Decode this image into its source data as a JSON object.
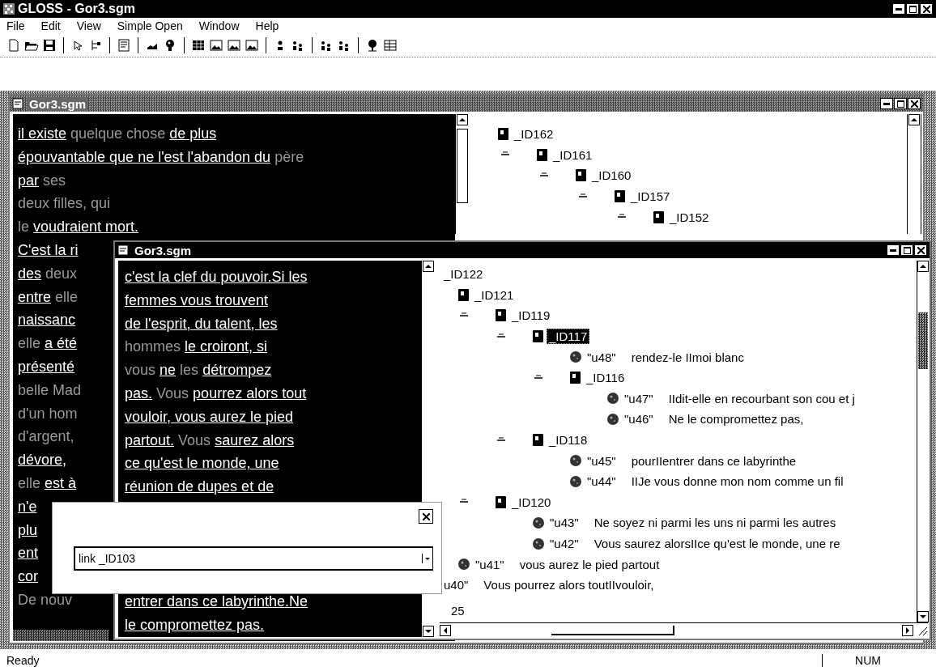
{
  "app_window": {
    "title": "GLOSS - Gor3.sgm"
  },
  "menu": [
    "File",
    "Edit",
    "View",
    "Simple Open",
    "Window",
    "Help"
  ],
  "back_window": {
    "title": "Gor3.sgm",
    "active": false,
    "text_lines": [
      [
        {
          "text": "il existe",
          "link": true
        },
        {
          "text": "quelque chose",
          "link": false
        },
        {
          "text": "de plus",
          "link": true
        }
      ],
      [
        {
          "text": "épouvantable que ne l'est l'abandon du",
          "link": true
        },
        {
          "text": "père",
          "link": false
        }
      ],
      [
        {
          "text": "par",
          "link": true
        },
        {
          "text": "ses",
          "link": false
        }
      ],
      [
        {
          "text": "deux filles, qui",
          "link": false
        }
      ],
      [
        {
          "text": "le",
          "link": false
        },
        {
          "text": "voudraient mort.",
          "link": true
        }
      ],
      [
        {
          "text": "C'est la ri",
          "link": true
        }
      ],
      [
        {
          "text": "des",
          "link": true
        },
        {
          "text": "deux",
          "link": false
        }
      ],
      [
        {
          "text": "entre",
          "link": true
        },
        {
          "text": "elle",
          "link": false
        }
      ],
      [
        {
          "text": "naissanc",
          "link": true
        }
      ],
      [
        {
          "text": "elle",
          "link": false
        },
        {
          "text": "a été",
          "link": true
        }
      ],
      [
        {
          "text": "présenté",
          "link": true
        }
      ],
      [
        {
          "text": "belle Mad",
          "link": false
        }
      ],
      [
        {
          "text": "d'un hom",
          "link": false
        }
      ],
      [
        {
          "text": "d'argent,",
          "link": false
        }
      ],
      [
        {
          "text": "dévore,",
          "link": true
        }
      ],
      [
        {
          "text": "elle",
          "link": false
        },
        {
          "text": "est à",
          "link": true
        }
      ],
      [
        {
          "text": "n'e",
          "link": true
        }
      ],
      [
        {
          "text": "plu",
          "link": true
        }
      ],
      [
        {
          "text": "ent",
          "link": true
        }
      ],
      [
        {
          "text": "cor",
          "link": true
        }
      ],
      [
        {
          "text": "De nouv",
          "link": false
        }
      ]
    ],
    "tree": [
      {
        "kind": "element",
        "label": "_ID162",
        "selected": false,
        "children": [
          {
            "kind": "element",
            "label": "_ID161",
            "expanded": true,
            "selected": false,
            "children": [
              {
                "kind": "element",
                "label": "_ID160",
                "expanded": true,
                "selected": false,
                "children": [
                  {
                    "kind": "element",
                    "label": "_ID157",
                    "expanded": true,
                    "selected": false,
                    "children": [
                      {
                        "kind": "element",
                        "label": "_ID152",
                        "expanded": true,
                        "selected": false
                      }
                    ]
                  }
                ]
              }
            ]
          }
        ]
      }
    ]
  },
  "front_window": {
    "title": "Gor3.sgm",
    "active": true,
    "text_above_dialog": [
      [
        {
          "text": "c'est la clef du pouvoir.Si les",
          "link": true
        }
      ],
      [
        {
          "text": "femmes vous trouvent",
          "link": true
        }
      ],
      [
        {
          "text": "de l'esprit, du talent, les",
          "link": true
        }
      ],
      [
        {
          "text": "hommes",
          "link": false
        },
        {
          "text": "le croiront, si",
          "link": true
        }
      ],
      [
        {
          "text": "vous",
          "link": false
        },
        {
          "text": "ne",
          "link": true
        },
        {
          "text": "les",
          "link": false
        },
        {
          "text": "détrompez",
          "link": true
        }
      ],
      [
        {
          "text": "pas.",
          "link": true
        },
        {
          "text": "Vous",
          "link": false
        },
        {
          "text": "pourrez alors tout",
          "link": true
        }
      ],
      [
        {
          "text": "vouloir, vous aurez le pied",
          "link": true
        }
      ],
      [
        {
          "text": "partout.",
          "link": true
        },
        {
          "text": "Vous",
          "link": false
        },
        {
          "text": "saurez alors",
          "link": true
        }
      ],
      [
        {
          "text": "ce qu'est le monde, une",
          "link": true
        }
      ],
      [
        {
          "text": "réunion de dupes et de",
          "link": true
        }
      ]
    ],
    "text_below_dialog": [
      [
        {
          "text": "entrer dans ce labyrinthe.Ne",
          "link": true
        }
      ],
      [
        {
          "text": "le compromettez pas.",
          "link": true
        }
      ]
    ],
    "tree": [
      {
        "kind": "clipped",
        "label": "_ID122",
        "selected": false,
        "children": [
          {
            "kind": "element",
            "label": "_ID121",
            "selected": false,
            "children": [
              {
                "kind": "element",
                "label": "_ID119",
                "expanded": true,
                "selected": false,
                "children": [
                  {
                    "kind": "element",
                    "label": "_ID117",
                    "expanded": true,
                    "selected": true,
                    "children": [
                      {
                        "kind": "text",
                        "label": "\"u48\"",
                        "text": "rendez-le IImoi blanc",
                        "selected": false
                      },
                      {
                        "kind": "element",
                        "label": "_ID116",
                        "expanded": true,
                        "selected": false,
                        "children": [
                          {
                            "kind": "text",
                            "label": "\"u47\"",
                            "text": "IIdit-elle en recourbant son cou et j",
                            "selected": false
                          },
                          {
                            "kind": "text",
                            "label": "\"u46\"",
                            "text": "Ne le compromettez pas,",
                            "selected": false
                          }
                        ]
                      }
                    ]
                  },
                  {
                    "kind": "element",
                    "label": "_ID118",
                    "expanded": true,
                    "selected": false,
                    "children": [
                      {
                        "kind": "text",
                        "label": "\"u45\"",
                        "text": "pourIIentrer dans ce labyrinthe",
                        "selected": false
                      },
                      {
                        "kind": "text",
                        "label": "\"u44\"",
                        "text": "IIJe vous donne mon nom comme un fil",
                        "selected": false
                      }
                    ]
                  }
                ]
              },
              {
                "kind": "element",
                "label": "_ID120",
                "expanded": true,
                "selected": false,
                "children": [
                  {
                    "kind": "text",
                    "label": "\"u43\"",
                    "text": "Ne soyez ni parmi les uns ni parmi les autres",
                    "selected": false
                  },
                  {
                    "kind": "text",
                    "label": "\"u42\"",
                    "text": "Vous saurez alorsIIce qu'est le monde, une re",
                    "selected": false
                  }
                ]
              }
            ]
          },
          {
            "kind": "text",
            "label": "\"u41\"",
            "text": "vous aurez le pied partout",
            "selected": false
          }
        ]
      },
      {
        "kind": "clipped",
        "label": "u40\"",
        "text": "Vous pourrez alors toutIIvouloir,",
        "selected": false
      }
    ],
    "counter": "25"
  },
  "dialog": {
    "field_value": "link _ID103"
  },
  "status_bar": {
    "message": "Ready",
    "indicator": "NUM"
  }
}
